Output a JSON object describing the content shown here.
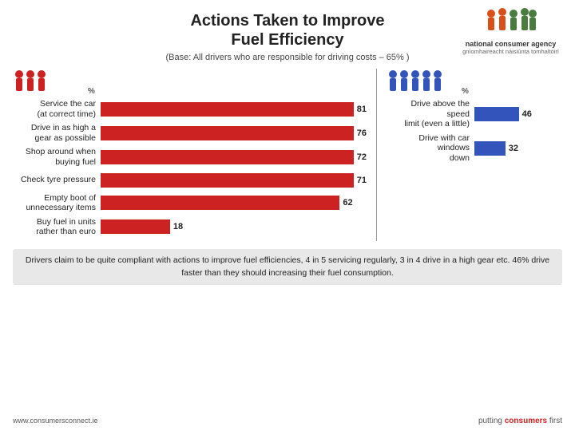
{
  "header": {
    "title_line1": "Actions Taken to Improve",
    "title_line2": "Fuel Efficiency",
    "subtitle": "(Base: All drivers who are responsible for driving costs – 65% )",
    "logo": {
      "text_main": "national consumer agency",
      "text_sub": "gníomhaireacht náisiúnta tomhaltóirí"
    }
  },
  "left_chart": {
    "percent_label": "%",
    "rows": [
      {
        "label": "Service the car\n(at correct time)",
        "value": 81,
        "max": 100
      },
      {
        "label": "Drive in as high a\ngear as possible",
        "value": 76,
        "max": 100
      },
      {
        "label": "Shop around when\nbuying fuel",
        "value": 72,
        "max": 100
      },
      {
        "label": "Check tyre pressure",
        "value": 71,
        "max": 100
      },
      {
        "label": "Empty boot of\nunnecessary items",
        "value": 62,
        "max": 100
      },
      {
        "label": "Buy fuel in units\nrather than euro",
        "value": 18,
        "max": 100
      }
    ]
  },
  "right_chart": {
    "percent_label": "%",
    "rows": [
      {
        "label": "Drive above the speed\nlimit (even a little)",
        "value": 46,
        "max": 100
      },
      {
        "label": "Drive with car windows\ndown",
        "value": 32,
        "max": 100
      }
    ]
  },
  "footer": {
    "text": "Drivers claim to be quite compliant with actions to improve fuel efficiencies, 4 in 5 servicing regularly, 3 in 4 drive in a high gear etc. 46% drive faster than they should increasing their fuel consumption."
  },
  "bottom_bar": {
    "website": "www.consumersconnect.ie",
    "putting_text": "putting ",
    "consumers_text": "consumers",
    "first_text": " first"
  }
}
